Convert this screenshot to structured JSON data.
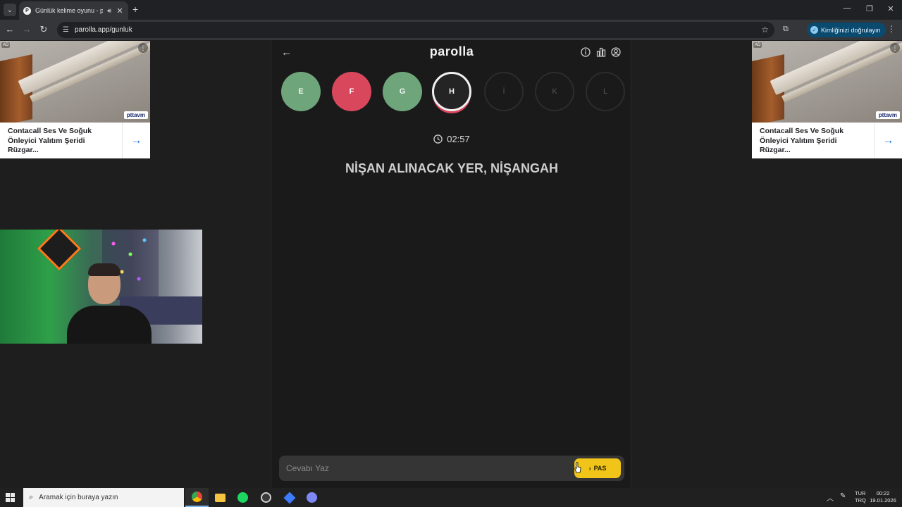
{
  "browser": {
    "tab_title": "Günlük kelime oyunu - parolla",
    "url": "parolla.app/gunluk",
    "verify_label": "Kimliğinizi doğrulayın"
  },
  "ads": {
    "left": {
      "badge": "AD",
      "brand": "pttavm",
      "text": "Contacall Ses Ve Soğuk Önleyici Yalıtım Şeridi Rüzgar..."
    },
    "right": {
      "badge": "AD",
      "brand": "pttavm",
      "text": "Contacall Ses Ve Soğuk Önleyici Yalıtım Şeridi Rüzgar..."
    }
  },
  "game": {
    "title": "parolla",
    "letters": [
      {
        "char": "E",
        "state": "correct"
      },
      {
        "char": "F",
        "state": "wrong"
      },
      {
        "char": "G",
        "state": "correct"
      },
      {
        "char": "H",
        "state": "active"
      },
      {
        "char": "İ",
        "state": "pending"
      },
      {
        "char": "K",
        "state": "pending"
      },
      {
        "char": "L",
        "state": "pending"
      }
    ],
    "timer": "02:57",
    "question": "NİŞAN ALINACAK YER, NİŞANGAH",
    "answer_placeholder": "Cevabı Yaz",
    "pass_label": "PAS"
  },
  "taskbar": {
    "search_placeholder": "Aramak için buraya yazın",
    "apps": [
      "chrome-icon",
      "file-explorer-icon",
      "spotify-icon",
      "obs-icon",
      "app-icon",
      "discord-icon"
    ],
    "lang_top": "TUR",
    "lang_bottom": "TRQ",
    "time": "00:22",
    "date": "19.01.2026"
  },
  "colors": {
    "correct": "#6fa57a",
    "wrong": "#d9475d",
    "pass_button": "#f0c419",
    "verify_button": "#0b4a6f"
  }
}
